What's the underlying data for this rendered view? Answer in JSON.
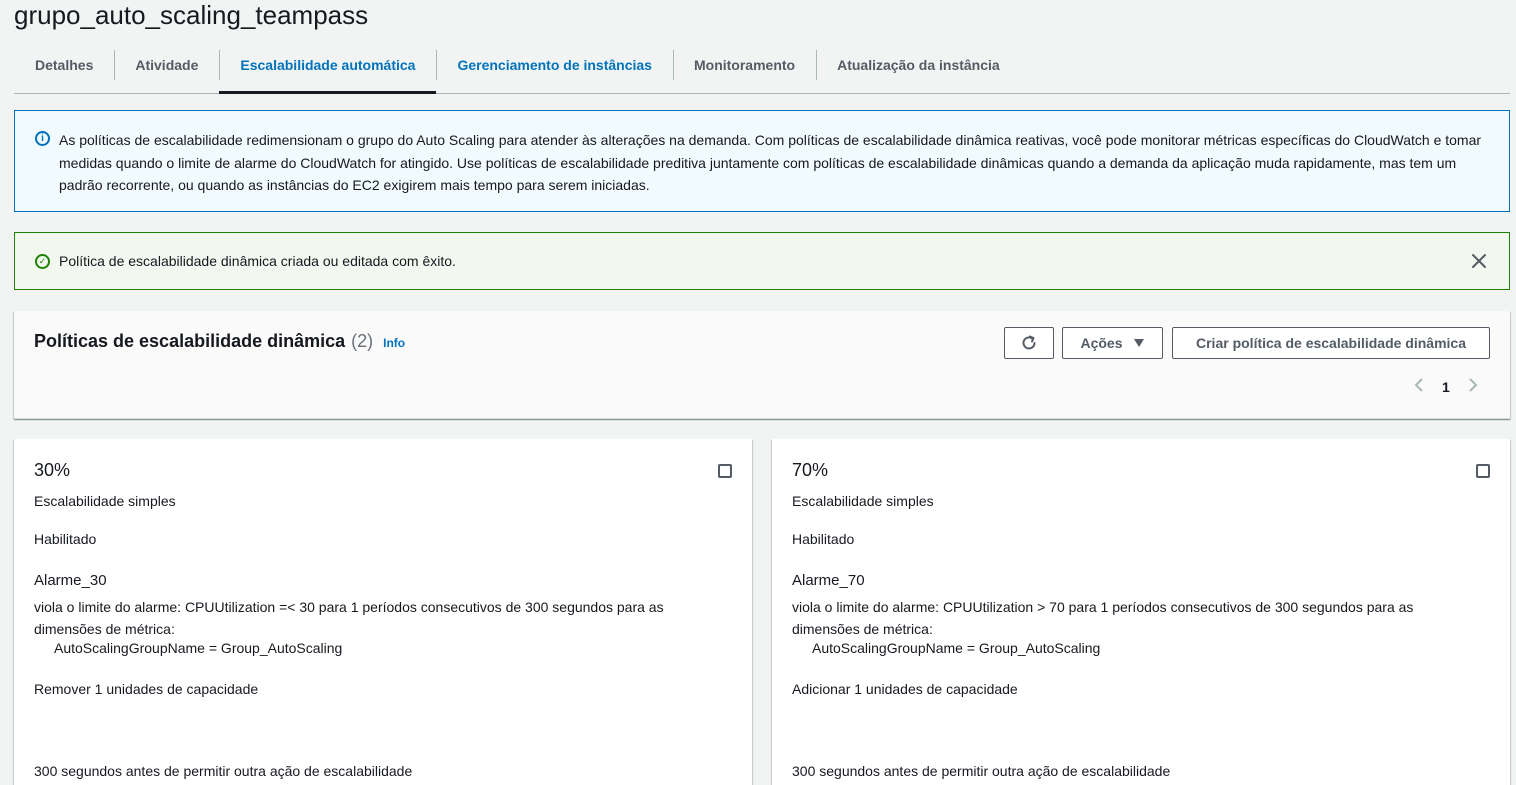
{
  "page": {
    "title": "grupo_auto_scaling_teampass"
  },
  "tabs": [
    {
      "label": "Detalhes"
    },
    {
      "label": "Atividade"
    },
    {
      "label": "Escalabilidade automática"
    },
    {
      "label": "Gerenciamento de instâncias"
    },
    {
      "label": "Monitoramento"
    },
    {
      "label": "Atualização da instância"
    }
  ],
  "info_alert": {
    "text": "As políticas de escalabilidade redimensionam o grupo do Auto Scaling para atender às alterações na demanda. Com políticas de escalabilidade dinâmica reativas, você pode monitorar métricas específicas do CloudWatch e tomar medidas quando o limite de alarme do CloudWatch for atingido. Use políticas de escalabilidade preditiva juntamente com políticas de escalabilidade dinâmicas quando a demanda da aplicação muda rapidamente, mas tem um padrão recorrente, ou quando as instâncias do EC2 exigirem mais tempo para serem iniciadas."
  },
  "success_alert": {
    "text": "Política de escalabilidade dinâmica criada ou editada com êxito."
  },
  "policies": {
    "title": "Políticas de escalabilidade dinâmica",
    "count": "(2)",
    "info_label": "Info",
    "actions_label": "Ações",
    "create_label": "Criar política de escalabilidade dinâmica",
    "page_number": "1"
  },
  "cards": [
    {
      "name": "30%",
      "type": "Escalabilidade simples",
      "status": "Habilitado",
      "alarm": "Alarme_30",
      "description": "viola o limite do alarme: CPUUtilization =< 30 para 1 períodos consecutivos de 300 segundos para as dimensões de métrica:",
      "dimension": "AutoScalingGroupName = Group_AutoScaling",
      "action": "Remover 1 unidades de capacidade",
      "cooldown": "300 segundos antes de permitir outra ação de escalabilidade"
    },
    {
      "name": "70%",
      "type": "Escalabilidade simples",
      "status": "Habilitado",
      "alarm": "Alarme_70",
      "description": "viola o limite do alarme: CPUUtilization > 70 para 1 períodos consecutivos de 300 segundos para as dimensões de métrica:",
      "dimension": "AutoScalingGroupName = Group_AutoScaling",
      "action": "Adicionar 1 unidades de capacidade",
      "cooldown": "300 segundos antes de permitir outra ação de escalabilidade"
    }
  ],
  "colors": {
    "link": "#0073bb",
    "info_border": "#0073bb",
    "success_border": "#1d8102",
    "text": "#16191f"
  }
}
